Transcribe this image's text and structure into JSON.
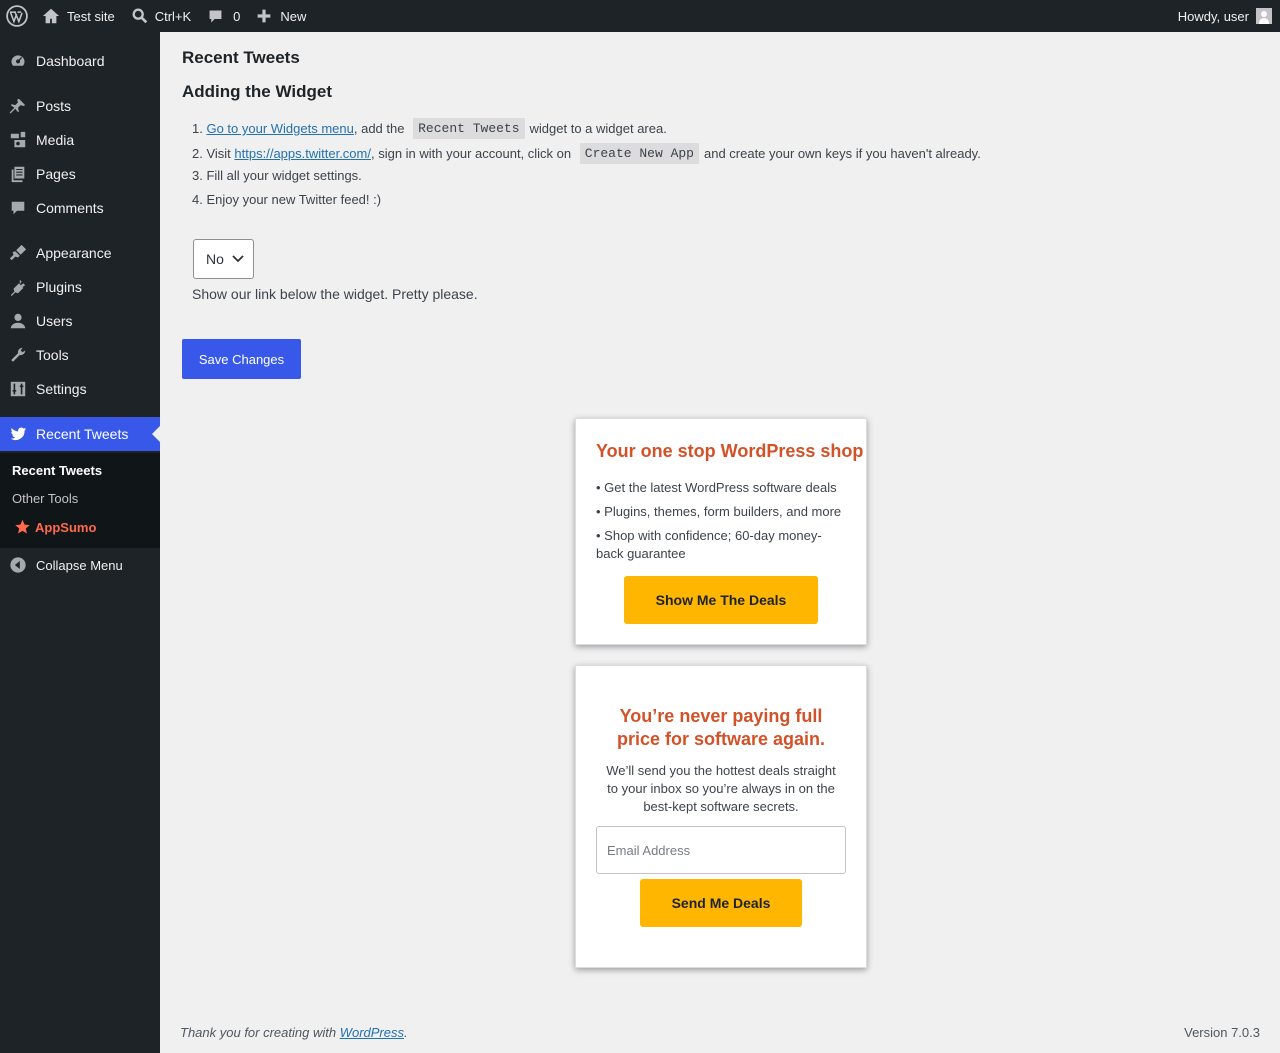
{
  "adminbar": {
    "site_name": "Test site",
    "search_shortcut": "Ctrl+K",
    "comments_count": "0",
    "new_label": "New",
    "howdy": "Howdy, user"
  },
  "sidebar": {
    "items": [
      {
        "label": "Dashboard",
        "icon": "dashboard-icon"
      },
      {
        "label": "Posts",
        "icon": "pin-icon"
      },
      {
        "label": "Media",
        "icon": "media-icon"
      },
      {
        "label": "Pages",
        "icon": "pages-icon"
      },
      {
        "label": "Comments",
        "icon": "comment-icon"
      },
      {
        "label": "Appearance",
        "icon": "brush-icon"
      },
      {
        "label": "Plugins",
        "icon": "plug-icon"
      },
      {
        "label": "Users",
        "icon": "user-icon"
      },
      {
        "label": "Tools",
        "icon": "wrench-icon"
      },
      {
        "label": "Settings",
        "icon": "sliders-icon"
      },
      {
        "label": "Recent Tweets",
        "icon": "twitter-icon",
        "current": true
      }
    ],
    "submenu": [
      "Recent Tweets",
      "Other Tools",
      "AppSumo"
    ],
    "collapse_label": "Collapse Menu"
  },
  "main": {
    "page_title": "Recent Tweets",
    "section_title": "Adding the Widget",
    "steps": {
      "s1_num": "1.",
      "s1_link": "Go to your Widgets menu",
      "s1_mid": ", add the",
      "s1_code": "Recent Tweets",
      "s1_end": "widget to a widget area.",
      "s2_num": "2.",
      "s2_pre": "Visit",
      "s2_link": "https://apps.twitter.com/",
      "s2_mid": ", sign in with your account, click on",
      "s2_code": "Create New App",
      "s2_end": "and create your own keys if you haven't already.",
      "s3": "3. Fill all your widget settings.",
      "s4": "4. Enjoy your new Twitter feed! :)"
    },
    "link_select_value": "No",
    "link_desc": "Show our link below the widget. Pretty please.",
    "save_label": "Save Changes"
  },
  "promo1": {
    "title": "Your one stop WordPress shop",
    "bullets": [
      "• Get the latest WordPress software deals",
      "• Plugins, themes, form builders, and more",
      "• Shop with confidence; 60-day money-back guarantee"
    ],
    "button": "Show Me The Deals"
  },
  "promo2": {
    "title": "You’re never paying full price for software again.",
    "text": "We’ll send you the hottest deals straight to your inbox so you’re always in on the best-kept software secrets.",
    "email_placeholder": "Email Address",
    "button": "Send Me Deals"
  },
  "footer": {
    "thanks_pre": "Thank you for creating with",
    "thanks_link": "WordPress",
    "thanks_post": ".",
    "version": "Version 7.0.3"
  },
  "colors": {
    "accent": "#3858e9",
    "promo_title": "#d35228",
    "deal_button": "#ffb600",
    "appsumo": "#ff6a4d"
  }
}
